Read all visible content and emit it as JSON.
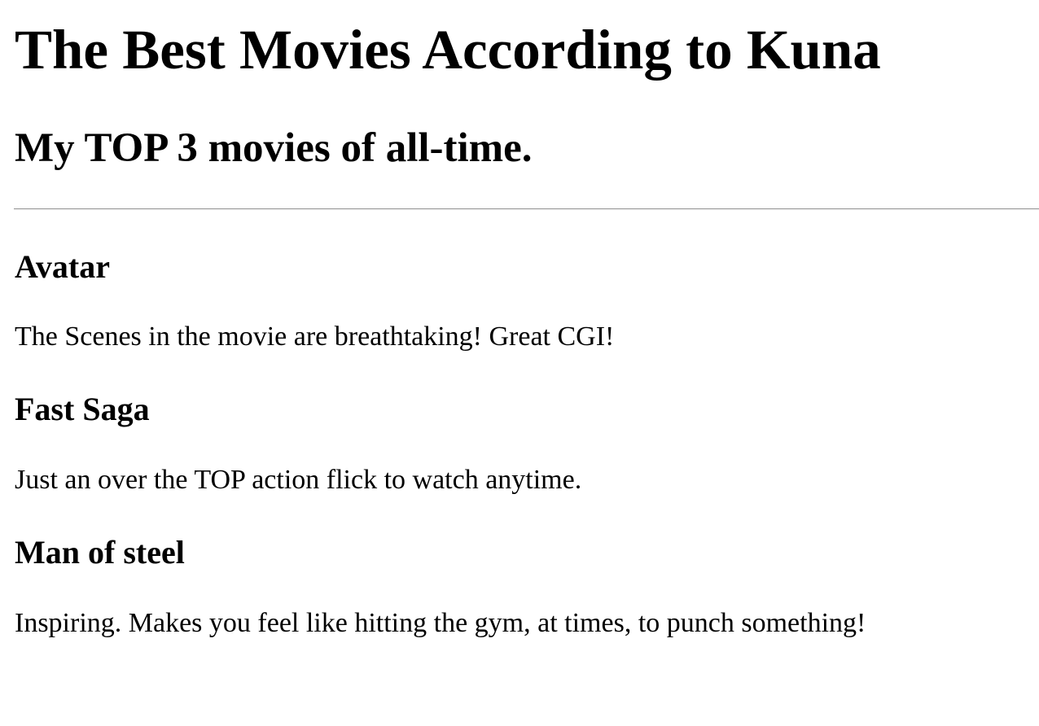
{
  "page": {
    "title": "The Best Movies According to Kuna",
    "subtitle": "My TOP 3 movies of all-time."
  },
  "movies": [
    {
      "title": "Avatar",
      "description": "The Scenes in the movie are breathtaking! Great CGI!"
    },
    {
      "title": "Fast Saga",
      "description": "Just an over the TOP action flick to watch anytime."
    },
    {
      "title": "Man of steel",
      "description": "Inspiring. Makes you feel like hitting the gym, at times, to punch something!"
    }
  ]
}
